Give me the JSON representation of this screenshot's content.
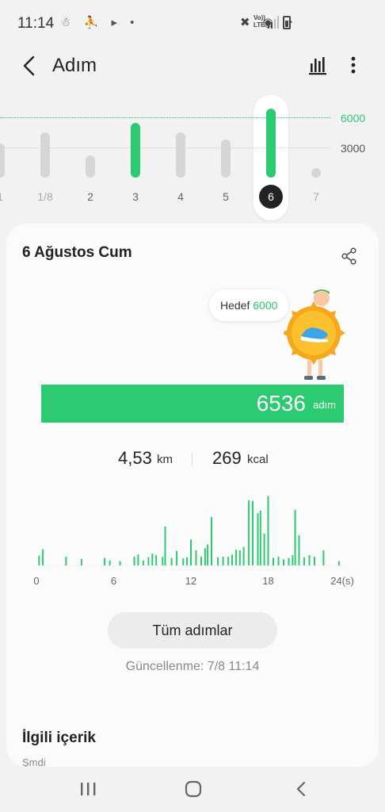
{
  "status_bar": {
    "time": "11:14",
    "left_icons": "☃ ⛹ ▸ •",
    "right_icons": "✖ ◉ ◔",
    "lte_top": "Vo))",
    "lte_bottom": "LTE"
  },
  "header": {
    "title": "Adım",
    "back_icon": "chevron-left-icon",
    "chart_icon": "bar-chart-icon",
    "more_icon": "more-vertical-icon"
  },
  "daily_chart": {
    "goal_labels": [
      "6000",
      "3000"
    ],
    "days": [
      {
        "label": "1",
        "steps": 3200,
        "faded": true
      },
      {
        "label": "1/8",
        "steps": 4300,
        "faded": true
      },
      {
        "label": "2",
        "steps": 2100,
        "faded": false
      },
      {
        "label": "3",
        "steps": 5200,
        "faded": false
      },
      {
        "label": "4",
        "steps": 4300,
        "faded": false
      },
      {
        "label": "5",
        "steps": 3600,
        "faded": false
      },
      {
        "label": "6",
        "steps": 6536,
        "faded": false
      },
      {
        "label": "7",
        "steps": 0,
        "faded": true
      }
    ],
    "selected_index": 6,
    "goal": 6000,
    "colors": {
      "achieved": "#2dcb71",
      "normal": "#d6d6d6",
      "goal_line": "#2dcb71",
      "line_3000": "#cccccc"
    }
  },
  "card": {
    "date": "6 Ağustos Cum",
    "share_icon": "share-icon",
    "goal_prefix": "Hedef",
    "goal_value": "6000",
    "steps_value": "6536",
    "steps_unit": "adım",
    "distance_value": "4,53",
    "distance_unit": "km",
    "calories_value": "269",
    "calories_unit": "kcal",
    "all_steps_label": "Tüm adımlar",
    "updated": "Güncellenme: 7/8 11:14",
    "related_title": "İlgili içerik",
    "related_sub": "Şmdi"
  },
  "chart_data": {
    "type": "bar",
    "x_tick_labels": [
      "0",
      "6",
      "12",
      "18",
      "24(s)"
    ],
    "xlim": [
      0,
      24
    ],
    "ylim": [
      0,
      1400
    ],
    "color": "#2dcb71",
    "values": [
      [
        0.2,
        180
      ],
      [
        0.5,
        300
      ],
      [
        2.3,
        160
      ],
      [
        3.5,
        120
      ],
      [
        5.3,
        140
      ],
      [
        5.7,
        90
      ],
      [
        6.5,
        80
      ],
      [
        7.6,
        160
      ],
      [
        7.9,
        200
      ],
      [
        8.3,
        90
      ],
      [
        8.7,
        150
      ],
      [
        9.0,
        220
      ],
      [
        9.3,
        190
      ],
      [
        9.8,
        160
      ],
      [
        10.0,
        720
      ],
      [
        10.5,
        140
      ],
      [
        10.9,
        270
      ],
      [
        11.4,
        130
      ],
      [
        11.7,
        150
      ],
      [
        12.0,
        480
      ],
      [
        12.4,
        280
      ],
      [
        12.8,
        160
      ],
      [
        13.1,
        320
      ],
      [
        13.3,
        390
      ],
      [
        13.6,
        900
      ],
      [
        14.1,
        150
      ],
      [
        14.5,
        160
      ],
      [
        14.9,
        160
      ],
      [
        15.2,
        200
      ],
      [
        15.5,
        290
      ],
      [
        15.8,
        280
      ],
      [
        16.1,
        340
      ],
      [
        16.5,
        1210
      ],
      [
        16.8,
        1200
      ],
      [
        17.2,
        970
      ],
      [
        17.4,
        1020
      ],
      [
        17.7,
        590
      ],
      [
        18.0,
        1290
      ],
      [
        18.4,
        140
      ],
      [
        18.8,
        160
      ],
      [
        19.2,
        110
      ],
      [
        19.6,
        140
      ],
      [
        19.9,
        190
      ],
      [
        20.1,
        1030
      ],
      [
        20.4,
        560
      ],
      [
        20.8,
        150
      ],
      [
        21.2,
        190
      ],
      [
        21.6,
        160
      ],
      [
        22.3,
        280
      ],
      [
        23.5,
        80
      ]
    ]
  },
  "nav": {
    "recent_icon": "recent-apps-icon",
    "home_icon": "home-icon",
    "back_icon": "back-icon"
  }
}
